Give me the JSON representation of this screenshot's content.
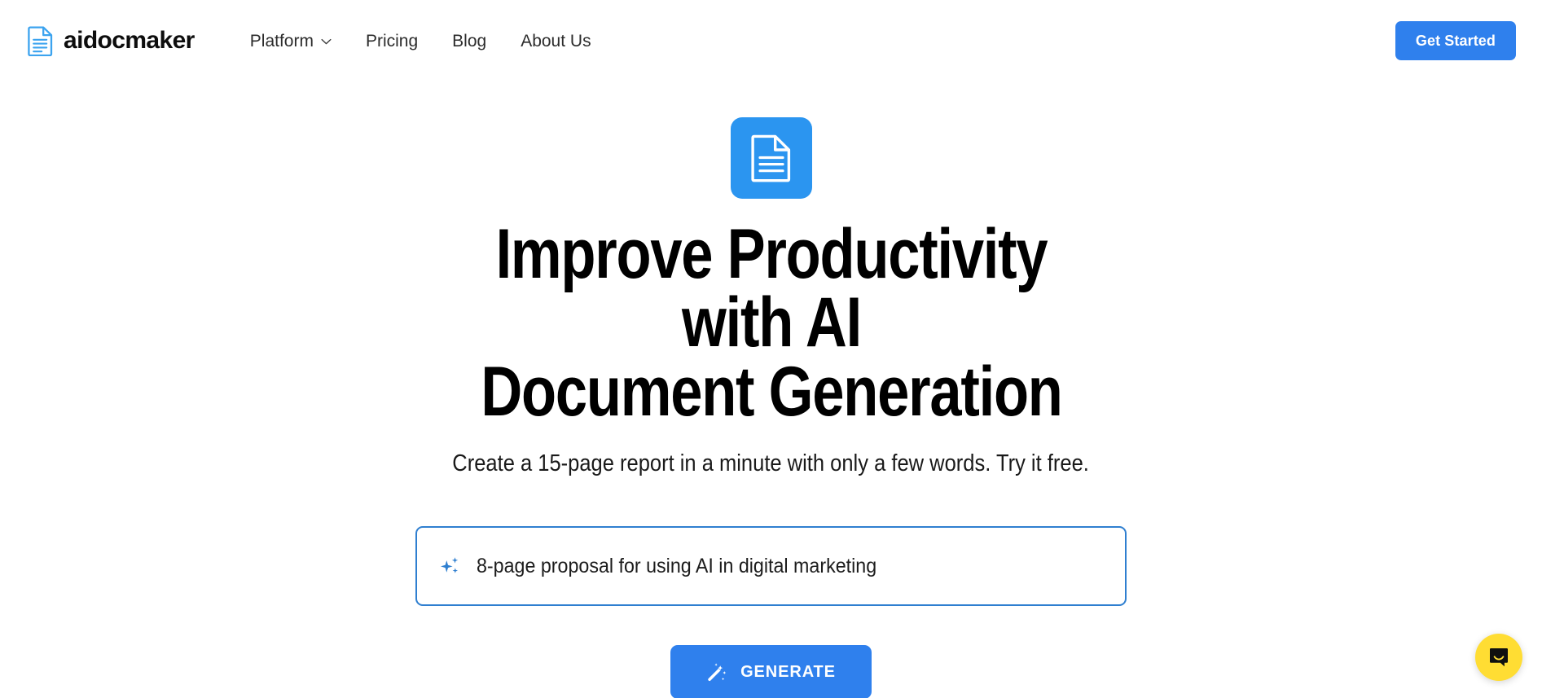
{
  "header": {
    "logo_icon": "document-icon",
    "brand_name": "aidocmaker",
    "nav_items": [
      {
        "label": "Platform",
        "has_dropdown": true,
        "dropdown_icon": "chevron-down-icon"
      },
      {
        "label": "Pricing",
        "has_dropdown": false
      },
      {
        "label": "Blog",
        "has_dropdown": false
      },
      {
        "label": "About Us",
        "has_dropdown": false
      }
    ],
    "cta_label": "Get Started"
  },
  "hero": {
    "badge_icon": "document-icon",
    "title_line_1": "Improve Productivity with AI",
    "title_line_2": "Document Generation",
    "subtitle": "Create a 15-page report in a minute with only a few words. Try it free."
  },
  "prompt": {
    "icon": "sparkle-ai-icon",
    "value": "8-page proposal for using AI in digital marketing",
    "placeholder": "8-page proposal for using AI in digital marketing"
  },
  "generate": {
    "icon": "magic-wand-icon",
    "label": "GENERATE"
  },
  "chat_widget": {
    "icon": "chat-bubble-icon",
    "aria_label": "Open Intercom Messenger"
  },
  "colors": {
    "accent_blue": "#2f80ed",
    "badge_blue": "#2b95f0",
    "input_border_blue": "#2f7fd0",
    "chat_yellow": "#ffdd33",
    "text_dark": "#111111"
  }
}
